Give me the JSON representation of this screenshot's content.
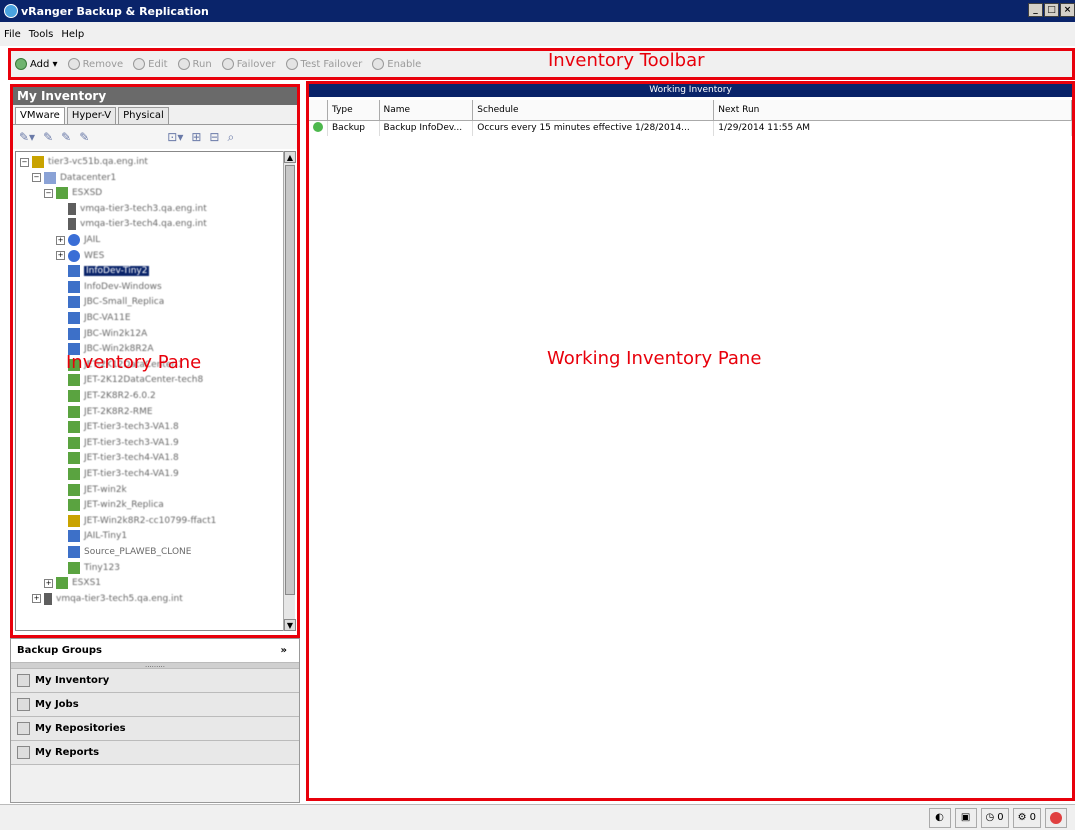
{
  "window": {
    "title": "vRanger Backup & Replication",
    "controls": [
      "_",
      "□",
      "×"
    ]
  },
  "menu": [
    "File",
    "Tools",
    "Help"
  ],
  "toolbar": {
    "buttons": [
      {
        "label": "Add ▾",
        "active": true
      },
      {
        "label": "Remove",
        "active": false
      },
      {
        "label": "Edit",
        "active": false
      },
      {
        "label": "Run",
        "active": false
      },
      {
        "label": "Failover",
        "active": false
      },
      {
        "label": "Test Failover",
        "active": false
      },
      {
        "label": "Enable",
        "active": false
      }
    ]
  },
  "annotations": {
    "toolbar": "Inventory Toolbar",
    "inventory_pane": "Inventory Pane",
    "working_pane": "Working Inventory Pane"
  },
  "inventory": {
    "header": "My Inventory",
    "tabs": [
      "VMware",
      "Hyper-V",
      "Physical"
    ],
    "tree": [
      {
        "indent": 0,
        "exp": "⊟",
        "icon": "root",
        "label": "tier3-vc51b.qa.eng.int",
        "blur": true
      },
      {
        "indent": 1,
        "exp": "⊟",
        "icon": "dc",
        "label": "Datacenter1",
        "blur": true
      },
      {
        "indent": 2,
        "exp": "⊟",
        "icon": "vmg",
        "label": "ESXSD",
        "blur": true
      },
      {
        "indent": 4,
        "exp": "",
        "icon": "host",
        "label": "vmqa-tier3-tech3.qa.eng.int",
        "blur": true
      },
      {
        "indent": 4,
        "exp": "",
        "icon": "host",
        "label": "vmqa-tier3-tech4.qa.eng.int",
        "blur": true
      },
      {
        "indent": 3,
        "exp": "⊞",
        "icon": "globe",
        "label": "JAIL",
        "blur": true
      },
      {
        "indent": 3,
        "exp": "⊞",
        "icon": "globe",
        "label": "WES",
        "blur": true
      },
      {
        "indent": 4,
        "exp": "",
        "icon": "vm",
        "label": "InfoDev-Tiny2",
        "blur": true,
        "selected": true
      },
      {
        "indent": 4,
        "exp": "",
        "icon": "vm",
        "label": "InfoDev-Windows",
        "blur": true
      },
      {
        "indent": 4,
        "exp": "",
        "icon": "vm",
        "label": "JBC-Small_Replica",
        "blur": true
      },
      {
        "indent": 4,
        "exp": "",
        "icon": "vm",
        "label": "JBC-VA11E",
        "blur": true
      },
      {
        "indent": 4,
        "exp": "",
        "icon": "vm",
        "label": "JBC-Win2k12A",
        "blur": true
      },
      {
        "indent": 4,
        "exp": "",
        "icon": "vm",
        "label": "JBC-Win2k8R2A",
        "blur": true
      },
      {
        "indent": 4,
        "exp": "",
        "icon": "vmg",
        "label": "JET-2K12DataCenter-1",
        "blur": true
      },
      {
        "indent": 4,
        "exp": "",
        "icon": "vmg",
        "label": "JET-2K12DataCenter-tech8",
        "blur": true
      },
      {
        "indent": 4,
        "exp": "",
        "icon": "vmg",
        "label": "JET-2K8R2-6.0.2",
        "blur": true
      },
      {
        "indent": 4,
        "exp": "",
        "icon": "vmg",
        "label": "JET-2K8R2-RME",
        "blur": true
      },
      {
        "indent": 4,
        "exp": "",
        "icon": "vmg",
        "label": "JET-tier3-tech3-VA1.8",
        "blur": true
      },
      {
        "indent": 4,
        "exp": "",
        "icon": "vmg",
        "label": "JET-tier3-tech3-VA1.9",
        "blur": true
      },
      {
        "indent": 4,
        "exp": "",
        "icon": "vmg",
        "label": "JET-tier3-tech4-VA1.8",
        "blur": true
      },
      {
        "indent": 4,
        "exp": "",
        "icon": "vmg",
        "label": "JET-tier3-tech4-VA1.9",
        "blur": true
      },
      {
        "indent": 4,
        "exp": "",
        "icon": "vmg",
        "label": "JET-win2k",
        "blur": true
      },
      {
        "indent": 4,
        "exp": "",
        "icon": "vmg",
        "label": "JET-win2k_Replica",
        "blur": true
      },
      {
        "indent": 4,
        "exp": "",
        "icon": "root",
        "label": "JET-Win2k8R2-cc10799-ffact1",
        "blur": true
      },
      {
        "indent": 4,
        "exp": "",
        "icon": "vm",
        "label": "JAIL-Tiny1",
        "blur": true
      },
      {
        "indent": 4,
        "exp": "",
        "icon": "vm",
        "label": "Source_PLAWEB_CLONE",
        "blur": false
      },
      {
        "indent": 4,
        "exp": "",
        "icon": "vmg",
        "label": "Tiny123",
        "blur": true
      },
      {
        "indent": 2,
        "exp": "⊞",
        "icon": "vmg",
        "label": "ESXS1",
        "blur": true
      },
      {
        "indent": 1,
        "exp": "⊞",
        "icon": "host",
        "label": "vmqa-tier3-tech5.qa.eng.int",
        "blur": true
      }
    ]
  },
  "accordion": {
    "backup_groups": "Backup Groups",
    "items": [
      {
        "label": "My Inventory",
        "icon": "inventory-icon"
      },
      {
        "label": "My Jobs",
        "icon": "jobs-icon"
      },
      {
        "label": "My Repositories",
        "icon": "repositories-icon"
      },
      {
        "label": "My Reports",
        "icon": "reports-icon"
      }
    ]
  },
  "working": {
    "header": "Working Inventory",
    "columns": [
      "Type",
      "Name",
      "Schedule",
      "Next Run"
    ],
    "rows": [
      {
        "type": "Backup",
        "name": "Backup InfoDev...",
        "schedule": "Occurs every 15 minutes  effective 1/28/2014...",
        "next_run": "1/29/2014 11:55 AM"
      }
    ]
  },
  "status": {
    "running": "0",
    "queued": "0"
  }
}
